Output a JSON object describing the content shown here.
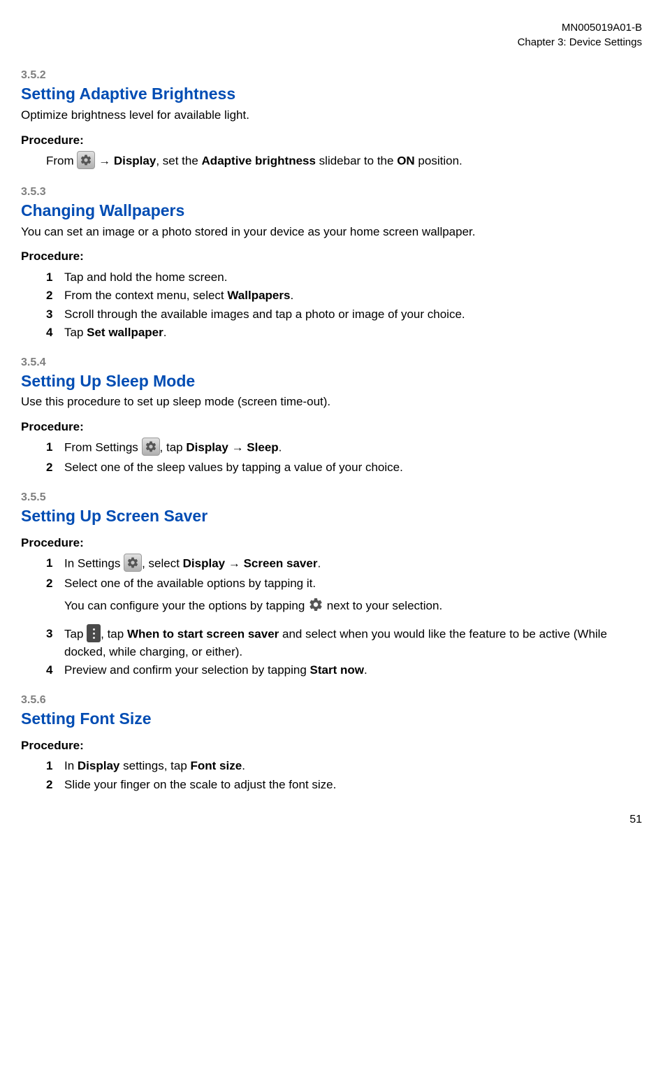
{
  "header": {
    "doc_id": "MN005019A01-B",
    "chapter": "Chapter 3:  Device Settings"
  },
  "page_number": "51",
  "sections": [
    {
      "num": "3.5.2",
      "title": "Setting Adaptive Brightness",
      "intro": "Optimize brightness level for available light.",
      "procedure_label": "Procedure:",
      "unnumbered_step": {
        "pre": "From ",
        "icon": "settings",
        "mid1": " → ",
        "b1": "Display",
        "mid2": ", set the ",
        "b2": "Adaptive brightness",
        "mid3": " slidebar to the ",
        "b3": "ON",
        "mid4": " position."
      }
    },
    {
      "num": "3.5.3",
      "title": "Changing Wallpapers",
      "intro": "You can set an image or a photo stored in your device as your home screen wallpaper.",
      "procedure_label": "Procedure:",
      "steps": [
        {
          "n": "1",
          "parts": [
            {
              "t": "Tap and hold the home screen."
            }
          ]
        },
        {
          "n": "2",
          "parts": [
            {
              "t": "From the context menu, select "
            },
            {
              "b": "Wallpapers"
            },
            {
              "t": "."
            }
          ]
        },
        {
          "n": "3",
          "parts": [
            {
              "t": "Scroll through the available images and tap a photo or image of your choice."
            }
          ]
        },
        {
          "n": "4",
          "parts": [
            {
              "t": "Tap "
            },
            {
              "b": "Set wallpaper"
            },
            {
              "t": "."
            }
          ]
        }
      ]
    },
    {
      "num": "3.5.4",
      "title": "Setting Up Sleep Mode",
      "intro": "Use this procedure to set up sleep mode (screen time-out).",
      "procedure_label": "Procedure:",
      "steps": [
        {
          "n": "1",
          "parts": [
            {
              "t": "From Settings "
            },
            {
              "icon": "settings"
            },
            {
              "t": ", tap "
            },
            {
              "b": "Display"
            },
            {
              "t": " → "
            },
            {
              "b": "Sleep"
            },
            {
              "t": "."
            }
          ]
        },
        {
          "n": "2",
          "parts": [
            {
              "t": "Select one of the sleep values by tapping a value of your choice."
            }
          ]
        }
      ]
    },
    {
      "num": "3.5.5",
      "title": "Setting Up Screen Saver",
      "procedure_label": "Procedure:",
      "steps": [
        {
          "n": "1",
          "parts": [
            {
              "t": "In Settings "
            },
            {
              "icon": "settings"
            },
            {
              "t": ", select "
            },
            {
              "b": "Display"
            },
            {
              "t": " → "
            },
            {
              "b": "Screen saver"
            },
            {
              "t": "."
            }
          ]
        },
        {
          "n": "2",
          "parts": [
            {
              "t": "Select one of the available options by tapping it."
            }
          ],
          "extra_parts": [
            {
              "t": "You can configure your the options by tapping "
            },
            {
              "icon": "gear"
            },
            {
              "t": " next to your selection."
            }
          ]
        },
        {
          "n": "3",
          "parts": [
            {
              "t": "Tap "
            },
            {
              "icon": "overflow"
            },
            {
              "t": ", tap "
            },
            {
              "b": "When to start screen saver"
            },
            {
              "t": " and select when you would like the feature to be active (While docked, while charging, or either)."
            }
          ]
        },
        {
          "n": "4",
          "parts": [
            {
              "t": "Preview and confirm your selection by tapping "
            },
            {
              "b": "Start now"
            },
            {
              "t": "."
            }
          ]
        }
      ]
    },
    {
      "num": "3.5.6",
      "title": "Setting Font Size",
      "procedure_label": "Procedure:",
      "steps": [
        {
          "n": "1",
          "parts": [
            {
              "t": "In "
            },
            {
              "b": "Display"
            },
            {
              "t": " settings, tap "
            },
            {
              "b": "Font size"
            },
            {
              "t": "."
            }
          ]
        },
        {
          "n": "2",
          "parts": [
            {
              "t": "Slide your finger on the scale to adjust the font size."
            }
          ]
        }
      ]
    }
  ]
}
